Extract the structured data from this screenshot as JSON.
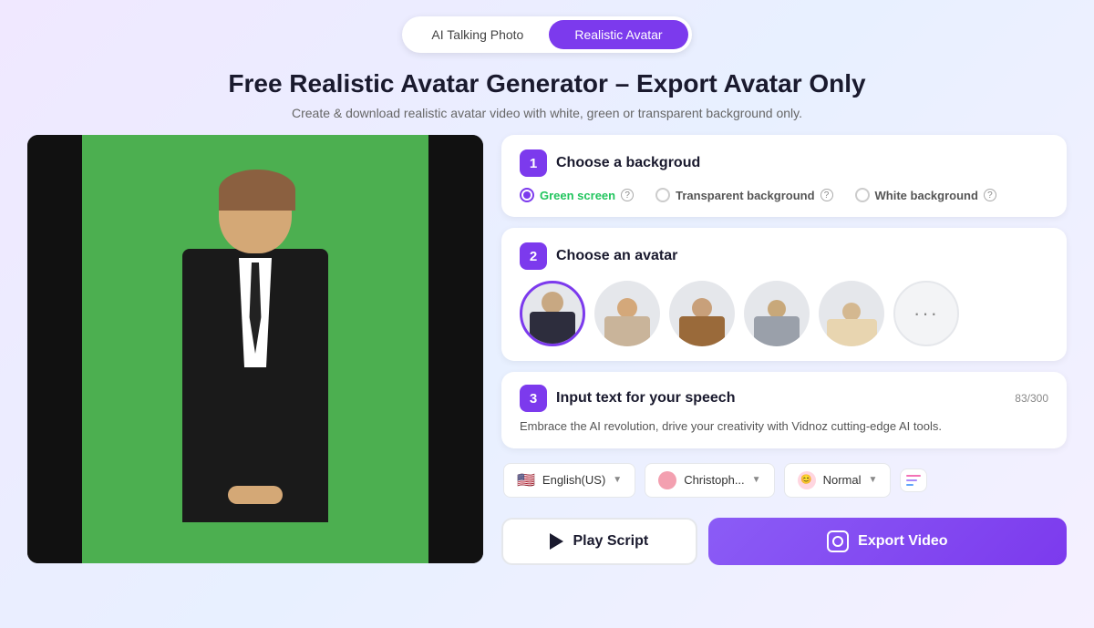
{
  "header": {
    "tab_inactive": "AI Talking Photo",
    "tab_active": "Realistic Avatar"
  },
  "title": {
    "main": "Free Realistic Avatar Generator – Export Avatar Only",
    "sub": "Create & download realistic avatar video with white, green or transparent background only."
  },
  "step1": {
    "badge": "1",
    "title": "Choose a backgroud",
    "options": [
      {
        "id": "green",
        "label": "Green screen",
        "active": true
      },
      {
        "id": "transparent",
        "label": "Transparent background",
        "active": false
      },
      {
        "id": "white",
        "label": "White background",
        "active": false
      }
    ]
  },
  "step2": {
    "badge": "2",
    "title": "Choose an avatar",
    "more_label": "···"
  },
  "step3": {
    "badge": "3",
    "title": "Input text for your speech",
    "char_count": "83/300",
    "speech_text": "Embrace the AI revolution, drive your creativity with Vidnoz cutting-edge AI tools."
  },
  "controls": {
    "language": "English(US)",
    "voice": "Christoph...",
    "speed": "Normal",
    "lang_flag": "🇺🇸"
  },
  "buttons": {
    "play": "Play Script",
    "export": "Export Video"
  }
}
